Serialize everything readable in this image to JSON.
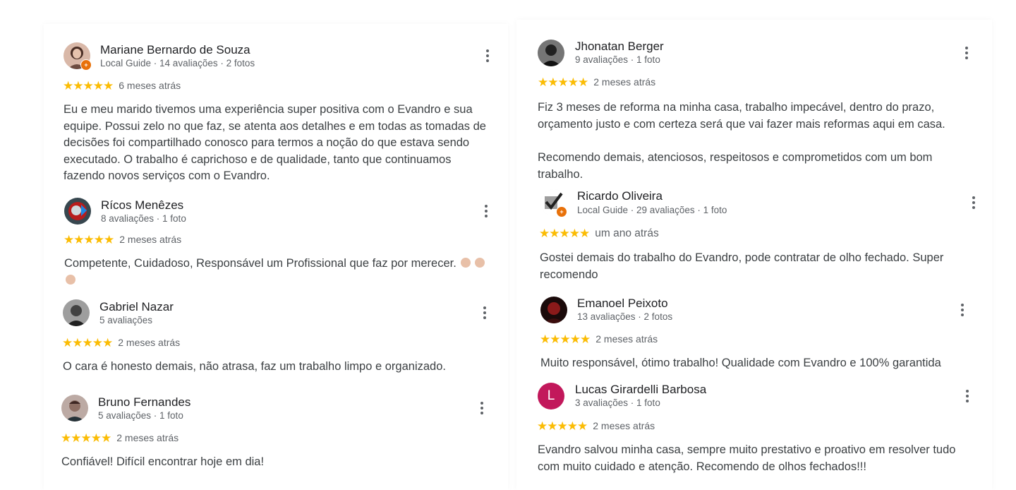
{
  "reviews_left": [
    {
      "name": "Mariane Bernardo de Souza",
      "meta": "Local Guide · 14 avaliações · 2 fotos",
      "date": "6 meses atrás",
      "rating": 5,
      "text": "Eu e meu marido tivemos uma experiência super positiva com o Evandro e sua equipe. Possui zelo no que faz, se atenta aos detalhes e em todas as tomadas de decisões foi compartilhado conosco para termos a noção do que estava sendo executado. O trabalho é caprichoso e de qualidade, tanto que continuamos fazendo novos serviços com o Evandro.",
      "local_guide": true
    },
    {
      "name": "Rícos Menêzes",
      "meta": "8 avaliações · 1 foto",
      "date": "2 meses atrás",
      "rating": 5,
      "text": "Competente, Cuidadoso, Responsável um Profissional que faz por merecer.",
      "local_guide": false
    },
    {
      "name": "Gabriel Nazar",
      "meta": "5 avaliações",
      "date": "2 meses atrás",
      "rating": 5,
      "text": "O cara é honesto demais, não atrasa, faz um trabalho limpo e organizado.",
      "local_guide": false
    },
    {
      "name": "Bruno Fernandes",
      "meta": "5 avaliações · 1 foto",
      "date": "2 meses atrás",
      "rating": 5,
      "text": "Confiável! Difícil encontrar hoje em dia!",
      "local_guide": false
    }
  ],
  "reviews_right": [
    {
      "name": "Jhonatan Berger",
      "meta": "9 avaliações · 1 foto",
      "date": "2 meses atrás",
      "rating": 5,
      "text": "Fiz 3 meses de reforma na minha casa, trabalho impecável, dentro do prazo, orçamento justo e com certeza será que vai fazer mais reformas aqui em casa.",
      "text2": "Recomendo demais, atenciosos, respeitosos e comprometidos com um bom trabalho.",
      "local_guide": false
    },
    {
      "name": "Ricardo Oliveira",
      "meta": "Local Guide · 29 avaliações · 1 foto",
      "date": "um ano atrás",
      "rating": 5,
      "text": "Gostei demais do trabalho do Evandro, pode contratar de olho fechado. Super recomendo",
      "local_guide": true
    },
    {
      "name": "Emanoel Peixoto",
      "meta": "13 avaliações · 2 fotos",
      "date": "2 meses atrás",
      "rating": 5,
      "text": "Muito responsável, ótimo trabalho! Qualidade com Evandro e 100% garantida",
      "local_guide": false
    },
    {
      "name": "Lucas Girardelli Barbosa",
      "meta": "3 avaliações · 1 foto",
      "date": "2 meses atrás",
      "rating": 5,
      "text": "Evandro salvou minha casa, sempre muito prestativo e proativo em resolver tudo com muito cuidado e atenção. Recomendo de olhos fechados!!!",
      "local_guide": false,
      "avatar_letter": "L"
    }
  ],
  "icons": {
    "star": "star-icon",
    "more": "more-vert-icon",
    "local_guide_badge": "local-guide-badge-icon"
  },
  "colors": {
    "star": "#fbbc04",
    "badge": "#e8710a",
    "letter_avatar": "#c2185b"
  }
}
